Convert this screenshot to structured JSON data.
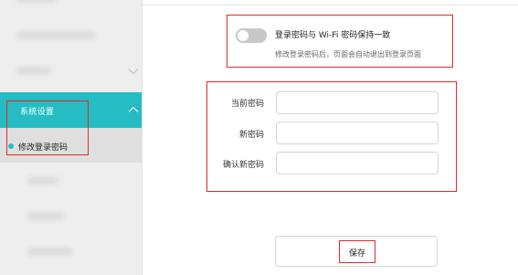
{
  "sidebar": {
    "section": {
      "label": "系统设置"
    },
    "active_item": {
      "label": "修改登录密码"
    }
  },
  "password_sync": {
    "toggle_label": "登录密码与 Wi-Fi 密码保持一致",
    "hint": "修改登录密码后，页面会自动退出到登录页面",
    "enabled": false
  },
  "form": {
    "current_password_label": "当前密码",
    "new_password_label": "新密码",
    "confirm_password_label": "确认新密码",
    "current_password_value": "",
    "new_password_value": "",
    "confirm_password_value": ""
  },
  "save_button": {
    "label": "保存"
  },
  "colors": {
    "accent": "#26bcc3",
    "highlight_border": "#e0282c",
    "sidebar_bg": "#eeeeee",
    "toggle_off": "#c8c8c8"
  }
}
